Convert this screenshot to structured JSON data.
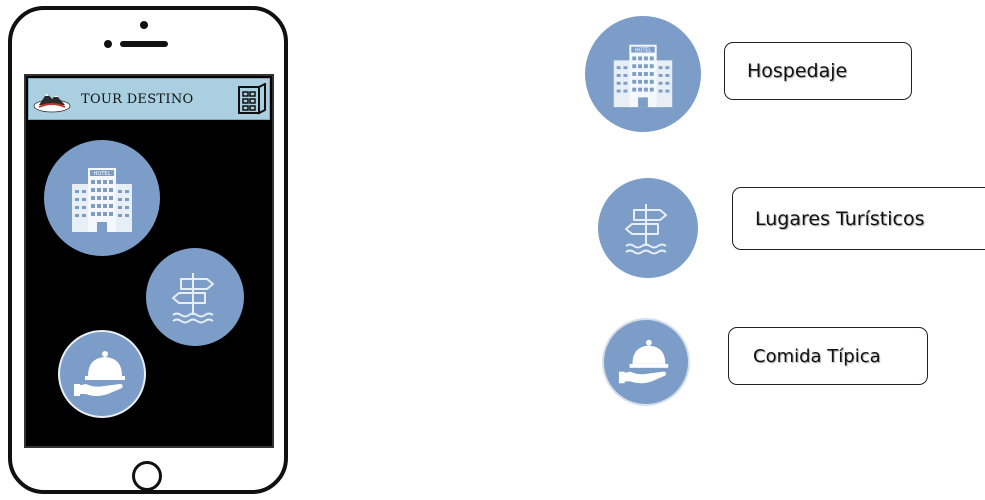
{
  "app": {
    "title": "TOUR DESTINO",
    "logo_icon": "mountain-logo-icon",
    "menu_icon": "building-menu-icon"
  },
  "phone": {
    "icons": [
      {
        "name": "hotel",
        "icon": "hotel-icon"
      },
      {
        "name": "tourist-places",
        "icon": "signpost-icon"
      },
      {
        "name": "food",
        "icon": "food-cloche-icon"
      }
    ]
  },
  "legend": {
    "items": [
      {
        "label": "Hospedaje",
        "icon": "hotel-icon"
      },
      {
        "label": "Lugares Turísticos",
        "icon": "signpost-icon"
      },
      {
        "label": "Comida Típica",
        "icon": "food-cloche-icon"
      }
    ]
  },
  "colors": {
    "circle": "#7b9dc8",
    "appbar": "#a9cfe0",
    "screen": "#000000"
  }
}
